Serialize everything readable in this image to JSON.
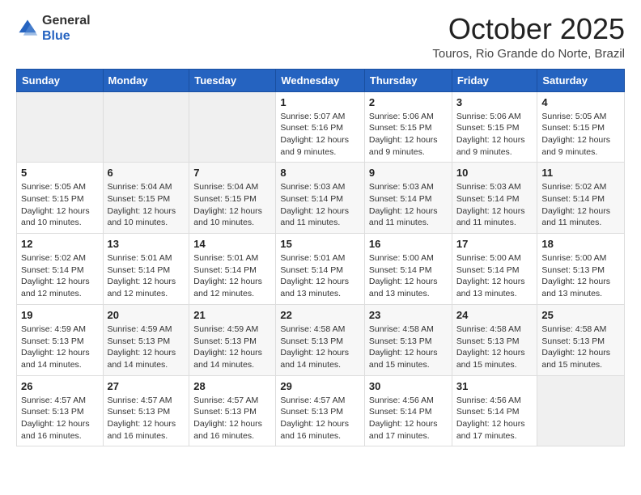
{
  "header": {
    "logo_line1": "General",
    "logo_line2": "Blue",
    "month": "October 2025",
    "location": "Touros, Rio Grande do Norte, Brazil"
  },
  "calendar": {
    "days_of_week": [
      "Sunday",
      "Monday",
      "Tuesday",
      "Wednesday",
      "Thursday",
      "Friday",
      "Saturday"
    ],
    "weeks": [
      [
        {
          "day": "",
          "info": ""
        },
        {
          "day": "",
          "info": ""
        },
        {
          "day": "",
          "info": ""
        },
        {
          "day": "1",
          "info": "Sunrise: 5:07 AM\nSunset: 5:16 PM\nDaylight: 12 hours\nand 9 minutes."
        },
        {
          "day": "2",
          "info": "Sunrise: 5:06 AM\nSunset: 5:15 PM\nDaylight: 12 hours\nand 9 minutes."
        },
        {
          "day": "3",
          "info": "Sunrise: 5:06 AM\nSunset: 5:15 PM\nDaylight: 12 hours\nand 9 minutes."
        },
        {
          "day": "4",
          "info": "Sunrise: 5:05 AM\nSunset: 5:15 PM\nDaylight: 12 hours\nand 9 minutes."
        }
      ],
      [
        {
          "day": "5",
          "info": "Sunrise: 5:05 AM\nSunset: 5:15 PM\nDaylight: 12 hours\nand 10 minutes."
        },
        {
          "day": "6",
          "info": "Sunrise: 5:04 AM\nSunset: 5:15 PM\nDaylight: 12 hours\nand 10 minutes."
        },
        {
          "day": "7",
          "info": "Sunrise: 5:04 AM\nSunset: 5:15 PM\nDaylight: 12 hours\nand 10 minutes."
        },
        {
          "day": "8",
          "info": "Sunrise: 5:03 AM\nSunset: 5:14 PM\nDaylight: 12 hours\nand 11 minutes."
        },
        {
          "day": "9",
          "info": "Sunrise: 5:03 AM\nSunset: 5:14 PM\nDaylight: 12 hours\nand 11 minutes."
        },
        {
          "day": "10",
          "info": "Sunrise: 5:03 AM\nSunset: 5:14 PM\nDaylight: 12 hours\nand 11 minutes."
        },
        {
          "day": "11",
          "info": "Sunrise: 5:02 AM\nSunset: 5:14 PM\nDaylight: 12 hours\nand 11 minutes."
        }
      ],
      [
        {
          "day": "12",
          "info": "Sunrise: 5:02 AM\nSunset: 5:14 PM\nDaylight: 12 hours\nand 12 minutes."
        },
        {
          "day": "13",
          "info": "Sunrise: 5:01 AM\nSunset: 5:14 PM\nDaylight: 12 hours\nand 12 minutes."
        },
        {
          "day": "14",
          "info": "Sunrise: 5:01 AM\nSunset: 5:14 PM\nDaylight: 12 hours\nand 12 minutes."
        },
        {
          "day": "15",
          "info": "Sunrise: 5:01 AM\nSunset: 5:14 PM\nDaylight: 12 hours\nand 13 minutes."
        },
        {
          "day": "16",
          "info": "Sunrise: 5:00 AM\nSunset: 5:14 PM\nDaylight: 12 hours\nand 13 minutes."
        },
        {
          "day": "17",
          "info": "Sunrise: 5:00 AM\nSunset: 5:14 PM\nDaylight: 12 hours\nand 13 minutes."
        },
        {
          "day": "18",
          "info": "Sunrise: 5:00 AM\nSunset: 5:13 PM\nDaylight: 12 hours\nand 13 minutes."
        }
      ],
      [
        {
          "day": "19",
          "info": "Sunrise: 4:59 AM\nSunset: 5:13 PM\nDaylight: 12 hours\nand 14 minutes."
        },
        {
          "day": "20",
          "info": "Sunrise: 4:59 AM\nSunset: 5:13 PM\nDaylight: 12 hours\nand 14 minutes."
        },
        {
          "day": "21",
          "info": "Sunrise: 4:59 AM\nSunset: 5:13 PM\nDaylight: 12 hours\nand 14 minutes."
        },
        {
          "day": "22",
          "info": "Sunrise: 4:58 AM\nSunset: 5:13 PM\nDaylight: 12 hours\nand 14 minutes."
        },
        {
          "day": "23",
          "info": "Sunrise: 4:58 AM\nSunset: 5:13 PM\nDaylight: 12 hours\nand 15 minutes."
        },
        {
          "day": "24",
          "info": "Sunrise: 4:58 AM\nSunset: 5:13 PM\nDaylight: 12 hours\nand 15 minutes."
        },
        {
          "day": "25",
          "info": "Sunrise: 4:58 AM\nSunset: 5:13 PM\nDaylight: 12 hours\nand 15 minutes."
        }
      ],
      [
        {
          "day": "26",
          "info": "Sunrise: 4:57 AM\nSunset: 5:13 PM\nDaylight: 12 hours\nand 16 minutes."
        },
        {
          "day": "27",
          "info": "Sunrise: 4:57 AM\nSunset: 5:13 PM\nDaylight: 12 hours\nand 16 minutes."
        },
        {
          "day": "28",
          "info": "Sunrise: 4:57 AM\nSunset: 5:13 PM\nDaylight: 12 hours\nand 16 minutes."
        },
        {
          "day": "29",
          "info": "Sunrise: 4:57 AM\nSunset: 5:13 PM\nDaylight: 12 hours\nand 16 minutes."
        },
        {
          "day": "30",
          "info": "Sunrise: 4:56 AM\nSunset: 5:14 PM\nDaylight: 12 hours\nand 17 minutes."
        },
        {
          "day": "31",
          "info": "Sunrise: 4:56 AM\nSunset: 5:14 PM\nDaylight: 12 hours\nand 17 minutes."
        },
        {
          "day": "",
          "info": ""
        }
      ]
    ]
  }
}
